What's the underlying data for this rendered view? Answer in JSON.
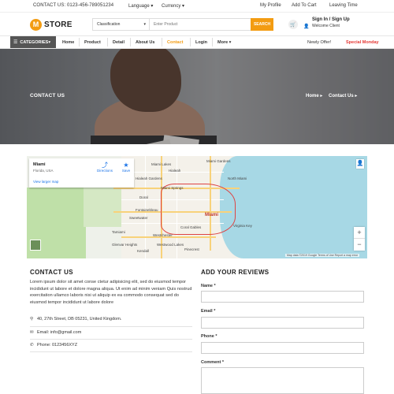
{
  "topbar": {
    "contact": "CONTACT US: 0123-456-789051234",
    "language": "Language",
    "currency": "Currency",
    "links": [
      "My Profile",
      "Add To Cart",
      "Leaving Time"
    ]
  },
  "header": {
    "logo_letter": "M",
    "logo_text": "STORE",
    "search_category": "Classification",
    "search_placeholder": "Enter Product",
    "search_button": "SEARCH",
    "signin": "Sign In / Sign Up",
    "welcome": "Welcome Client"
  },
  "nav": {
    "categories": "CATEGORIES",
    "items": [
      "Home",
      "Product",
      "Detail",
      "About Us",
      "Contact",
      "Login",
      "More"
    ],
    "active": "Contact",
    "newly": "Newly Offer!",
    "special": "Special Monday"
  },
  "banner": {
    "title": "CONTACT US",
    "breadcrumbs": [
      "Home ▸",
      "Contact Us ▸"
    ]
  },
  "map": {
    "place": "Miami",
    "place_sub": "Florida, USA",
    "directions": "Directions",
    "save": "Save",
    "larger_map": "View larger map",
    "labels": [
      "Hialeah",
      "Miami Springs",
      "Miami Lakes",
      "Hialeah Gardens",
      "Doral",
      "Sweetwater",
      "Coral Gables",
      "Miami",
      "Fontainebleau",
      "Westchester",
      "Tamiami",
      "Kendall",
      "Virginia Key",
      "Westwood Lakes",
      "Glenvar Heights",
      "Pinecrest",
      "Miami Gardens",
      "North Miami"
    ],
    "attribution": "Map data ©2019 Google   Terms of Use   Report a map error"
  },
  "contact": {
    "title": "CONTACT US",
    "text": "Lorem ipsum dolor sit amet conse ctetur adipisicing elit, sed do eiusmod tempor incididunt ut labore et dolore magna aliqua. Ut enim ad minim veniam Quis nostrud exercitation ullamco laboris nisi ut aliquip ex ea commodo consequat sed do eiusmod tempor incididunt ut labore dolore",
    "address": "40, 27th Street, DB 05231, United Kingdom.",
    "email": "Email: info@gmail.com",
    "phone": "Phone: 0123456XYZ"
  },
  "review": {
    "title": "ADD YOUR REVIEWS",
    "name_label": "Name",
    "email_label": "Email",
    "phone_label": "Phone",
    "comment_label": "Comment",
    "required_mark": "*"
  },
  "colors": {
    "accent": "#f39c12",
    "special": "#e53935",
    "category_bg": "#555555"
  }
}
